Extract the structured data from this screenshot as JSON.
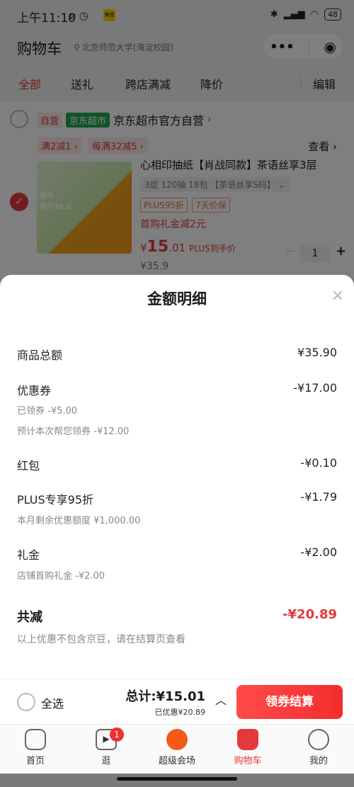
{
  "status_bar": {
    "time": "上午11:10",
    "battery": "48",
    "app_badge": "美团"
  },
  "header": {
    "title": "购物车",
    "location": "北京师范大学(海淀校园)"
  },
  "tabs": [
    "全部",
    "送礼",
    "跨店满减",
    "降价",
    "编辑"
  ],
  "store": {
    "badge_self": "自营",
    "badge_market": "京东超市",
    "name": "京东超市官方自营",
    "promos": [
      "满2减1",
      "每满32减5"
    ],
    "view": "查看",
    "product": {
      "title": "心相印抽纸【肖战同款】茶语丝享3层",
      "spec": "3层 120抽 18包 【茶语丝享S码】",
      "tags": [
        "PLUS95折",
        "7天价保"
      ],
      "gift": "首购礼金减2元",
      "price_symbol": "¥",
      "price_int": "15",
      "price_dec": ".01",
      "plus_note": "PLUS到手价",
      "orig_price": "¥35.9",
      "qty": "1",
      "img_label": "到手35.9",
      "img_top_label": "单件"
    }
  },
  "sheet": {
    "title": "金额明细",
    "rows": [
      {
        "label": "商品总额",
        "value": "¥35.90",
        "subs": []
      },
      {
        "label": "优惠券",
        "value": "-¥17.00",
        "subs": [
          "已领券 -¥5.00",
          "预计本次帮您领券 -¥12.00"
        ]
      },
      {
        "label": "红包",
        "value": "-¥0.10",
        "subs": []
      },
      {
        "label": "PLUS专享95折",
        "value": "-¥1.79",
        "subs": [
          "本月剩余优惠额度 ¥1,000.00"
        ]
      },
      {
        "label": "礼金",
        "value": "-¥2.00",
        "subs": [
          "店铺首购礼金 -¥2.00"
        ]
      }
    ],
    "total_label": "共减",
    "total_value": "-¥20.89",
    "note": "以上优惠不包含京豆，请在结算页查看"
  },
  "checkout": {
    "select_all": "全选",
    "total_label": "总计:",
    "total_value": "¥15.01",
    "saved": "已优惠¥20.89",
    "button": "领券结算"
  },
  "nav": [
    {
      "label": "首页",
      "icon": "home-icon"
    },
    {
      "label": "逛",
      "icon": "video-icon",
      "badge": "1"
    },
    {
      "label": "超级会场",
      "icon": "super-venue-icon"
    },
    {
      "label": "购物车",
      "icon": "cart-icon",
      "active": true
    },
    {
      "label": "我的",
      "icon": "profile-icon"
    }
  ],
  "colors": {
    "accent": "#e4393c",
    "green": "#1fa84a"
  }
}
